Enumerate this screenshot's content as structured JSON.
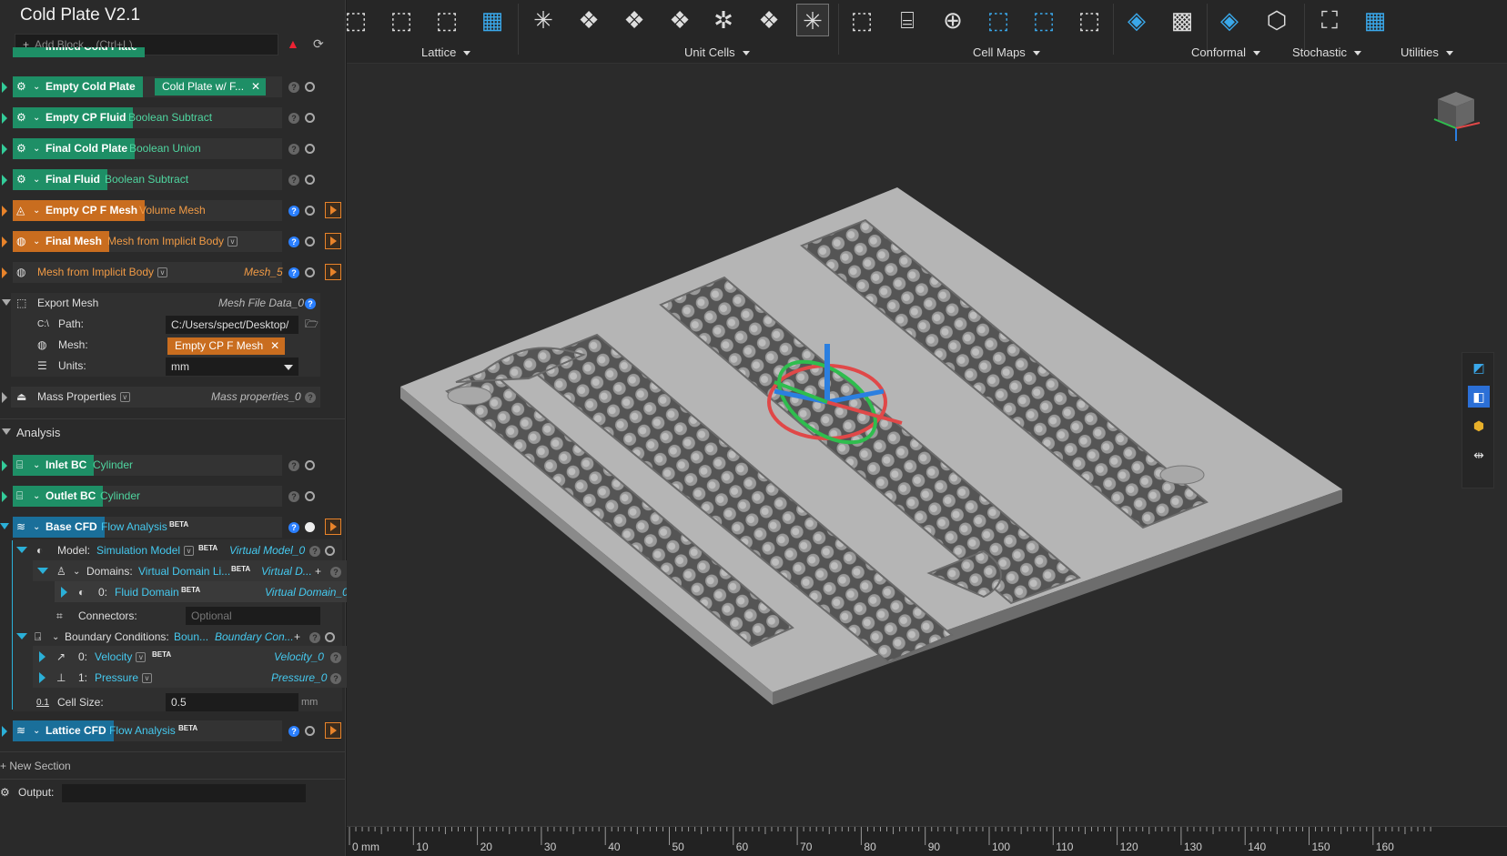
{
  "app": {
    "title": "Cold Plate V2.1",
    "add_block": "Add Block... (Ctrl+L)"
  },
  "blocks": [
    {
      "name": "Empty Cold Plate",
      "op": "Cold Plate w/ F...",
      "color": "green"
    },
    {
      "name": "Empty CP Fluid",
      "op": "Boolean Subtract",
      "color": "green"
    },
    {
      "name": "Final Cold Plate",
      "op": "Boolean Union",
      "color": "green"
    },
    {
      "name": "Final Fluid",
      "op": "Boolean Subtract",
      "color": "green"
    },
    {
      "name": "Empty CP F Mesh",
      "op": "Volume Mesh",
      "color": "orange"
    },
    {
      "name": "Final Mesh",
      "op": "Mesh from Implicit Body",
      "color": "orange"
    }
  ],
  "mesh_implicit": {
    "label": "Mesh from Implicit Body",
    "output": "Mesh_5"
  },
  "export_mesh": {
    "label": "Export Mesh",
    "output": "Mesh File Data_0",
    "path_label": "Path:",
    "path_value": "C:/Users/spect/Desktop/",
    "mesh_label": "Mesh:",
    "mesh_value": "Empty CP F Mesh",
    "units_label": "Units:",
    "units_value": "mm",
    "path_icon": "C:\\"
  },
  "mass": {
    "label": "Mass Properties",
    "output": "Mass properties_0"
  },
  "analysis": {
    "section": "Analysis",
    "inlet": {
      "name": "Inlet BC",
      "op": "Cylinder"
    },
    "outlet": {
      "name": "Outlet BC",
      "op": "Cylinder"
    },
    "base_cfd": {
      "name": "Base CFD",
      "op": "Flow Analysis",
      "beta": "BETA"
    },
    "model": {
      "label": "Model:",
      "value": "Simulation Model",
      "beta": "BETA",
      "output": "Virtual Model_0"
    },
    "domains": {
      "label": "Domains:",
      "value": "Virtual Domain Li...",
      "beta": "BETA",
      "output": "Virtual D..."
    },
    "fluid": {
      "index": "0:",
      "value": "Fluid Domain",
      "beta": "BETA",
      "output": "Virtual Domain_0"
    },
    "connectors": {
      "label": "Connectors:",
      "placeholder": "Optional"
    },
    "bcs": {
      "label": "Boundary Conditions:",
      "value": "Boun...",
      "output": "Boundary Con..."
    },
    "velocity": {
      "index": "0:",
      "value": "Velocity",
      "beta": "BETA",
      "output": "Velocity_0"
    },
    "pressure": {
      "index": "1:",
      "value": "Pressure",
      "output": "Pressure_0"
    },
    "cell": {
      "label": "Cell Size:",
      "value": "0.5",
      "unit": "mm",
      "icon": "0.1"
    },
    "lattice_cfd": {
      "name": "Lattice CFD",
      "op": "Flow Analysis",
      "beta": "BETA"
    }
  },
  "new_section": "New Section",
  "output_label": "Output:",
  "toolbar": {
    "groups": [
      "Lattice",
      "Unit Cells",
      "Cell Maps",
      "Conformal",
      "Stochastic",
      "Utilities"
    ]
  },
  "ruler": {
    "ticks": [
      "0 mm",
      "10",
      "20",
      "30",
      "40",
      "50",
      "60",
      "70",
      "80",
      "90",
      "100",
      "110",
      "120",
      "130",
      "140",
      "150",
      "160"
    ]
  },
  "partial_row": "Infilled Cold Plate"
}
